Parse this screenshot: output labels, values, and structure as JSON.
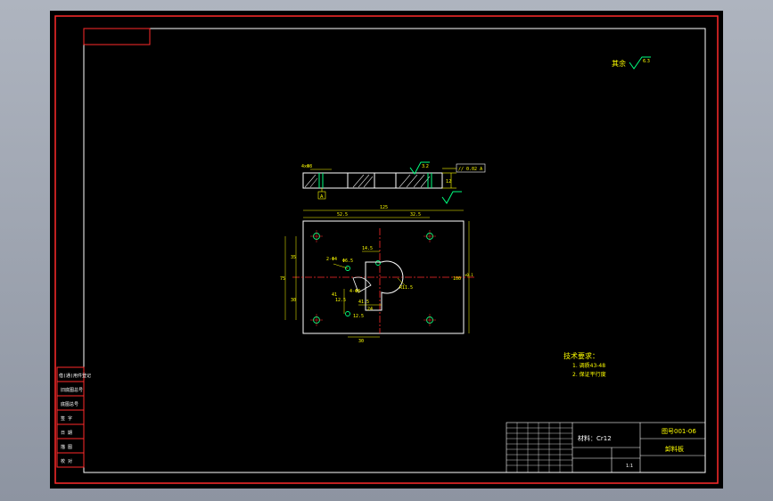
{
  "drawing": {
    "finish_label": "其余",
    "finish_value": "6.3",
    "section": {
      "tolerance_frame": "// 0.02 A",
      "datum": "A",
      "hole_callout": "4xΦ8",
      "finish_value": "3.2",
      "thickness": "12"
    },
    "plan": {
      "dim_overall_width": "125",
      "dim_left": "52.5",
      "dim_right": "32.5",
      "dim_left_height": "35",
      "dim_total_height": "75",
      "dim_lower": "30",
      "dim_right_height": "100",
      "dim_right_tol": "+0.1",
      "dim_holes": "2-Φ4",
      "dim_hole_dia": "Φ6.5",
      "dim_top_step": "14.5",
      "dim_radius": "R11.5",
      "dim_slot": "4-Φ8",
      "dim_small": "12.5",
      "dim_inner": "24",
      "dim_bottom": "30",
      "dim_c": "41",
      "dim_d": "12.5",
      "dim_e": "41.5"
    },
    "tech_req": {
      "title": "技术要求：",
      "items": [
        "1. 调质43-48",
        "2. 保证平行度"
      ]
    },
    "title_block": {
      "material": "材料：Cr12",
      "drawing_no": "图号001-06",
      "part_name": "卸料板",
      "scale": "1:1"
    },
    "side_table": {
      "rows": [
        "借(通)用件登记",
        "旧底图总号",
        "底图总号",
        "签 字",
        "日 期",
        "描 图",
        "校 对"
      ]
    }
  }
}
